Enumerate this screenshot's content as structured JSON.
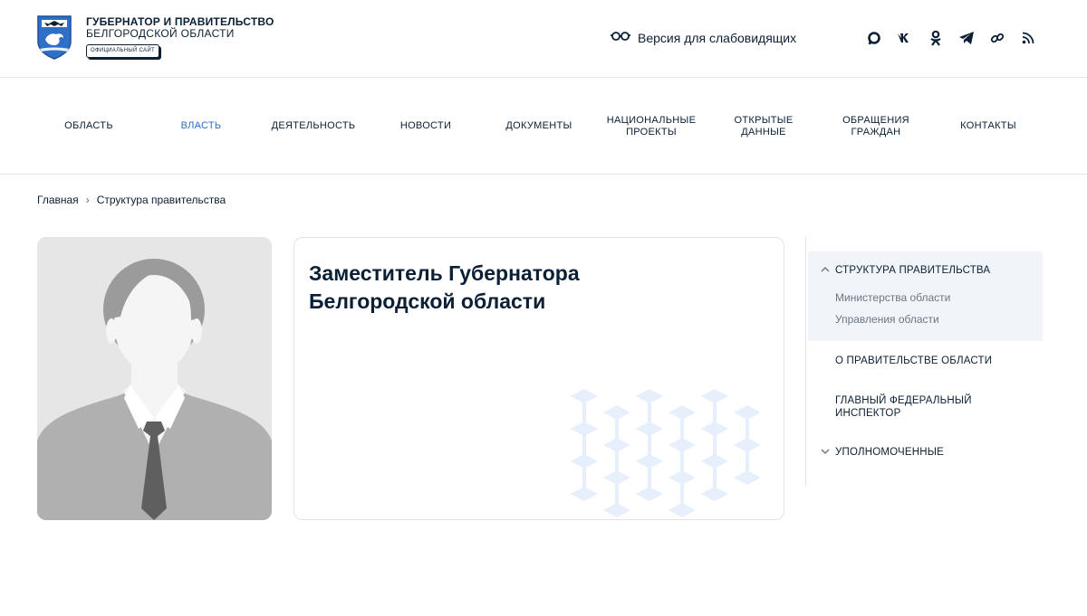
{
  "header": {
    "brand_line1": "ГУБЕРНАТОР И ПРАВИТЕЛЬСТВО",
    "brand_line2": "БЕЛГОРОДСКОЙ ОБЛАСТИ",
    "official_badge": "ОФИЦИАЛЬНЫЙ САЙТ",
    "vision_label": "Версия для слабовидящих",
    "socials": [
      "max-icon",
      "vk-icon",
      "ok-icon",
      "telegram-icon",
      "link-icon",
      "rss-icon"
    ]
  },
  "nav": {
    "items": [
      {
        "label": "ОБЛАСТЬ",
        "active": false
      },
      {
        "label": "ВЛАСТЬ",
        "active": true
      },
      {
        "label": "ДЕЯТЕЛЬНОСТЬ",
        "active": false
      },
      {
        "label": "НОВОСТИ",
        "active": false
      },
      {
        "label": "ДОКУМЕНТЫ",
        "active": false
      },
      {
        "label": "НАЦИОНАЛЬНЫЕ ПРОЕКТЫ",
        "active": false
      },
      {
        "label": "ОТКРЫТЫЕ ДАННЫЕ",
        "active": false
      },
      {
        "label": "ОБРАЩЕНИЯ ГРАЖДАН",
        "active": false
      },
      {
        "label": "КОНТАКТЫ",
        "active": false
      }
    ]
  },
  "breadcrumb": {
    "home": "Главная",
    "separator": "›",
    "current": "Структура правительства"
  },
  "card": {
    "title": "Заместитель Губернатора Белгородской области"
  },
  "sidebar": {
    "structure": "СТРУКТУРА ПРАВИТЕЛЬСТВА",
    "ministries": "Министерства области",
    "departments": "Управления области",
    "about": "О ПРАВИТЕЛЬСТВЕ ОБЛАСТИ",
    "inspector": "ГЛАВНЫЙ ФЕДЕРАЛЬНЫЙ ИНСПЕКТОР",
    "authorized": "УПОЛНОМОЧЕННЫЕ"
  },
  "colors": {
    "text": "#0b1f35",
    "accent": "#2f6fc7",
    "pattern": "#e6effb",
    "sidebar_bg": "#f1f4f8"
  }
}
